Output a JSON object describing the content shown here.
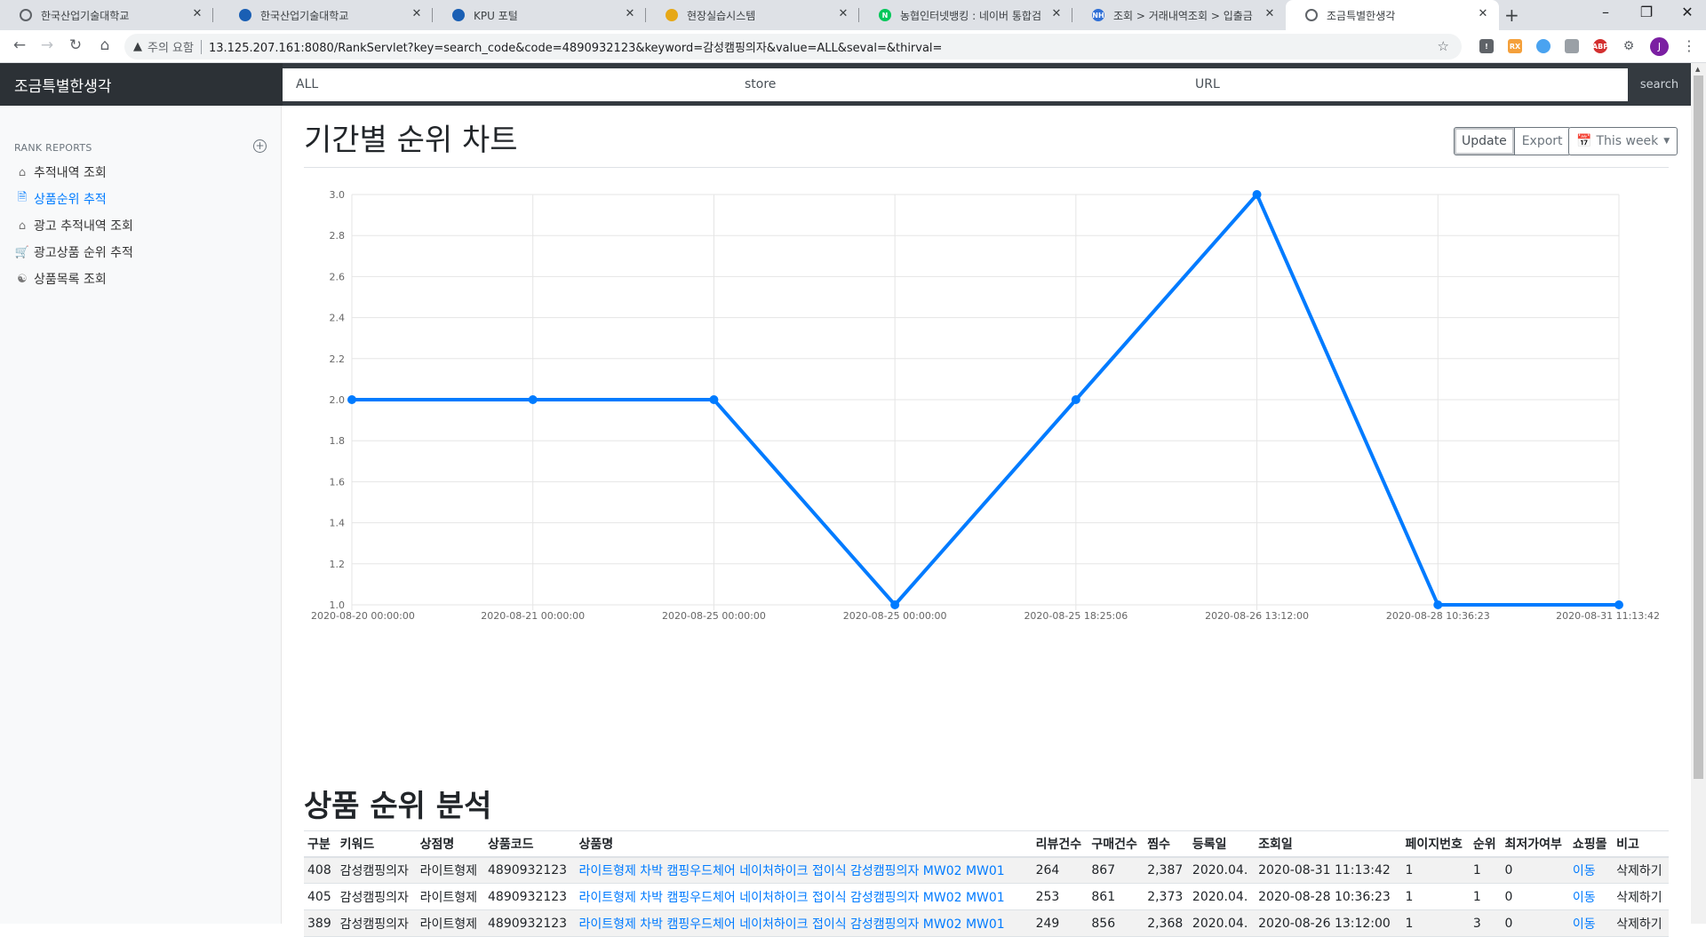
{
  "browser": {
    "tabs": [
      {
        "title": "한국산업기술대학교",
        "fav": "globe",
        "fav_color": "#5f6368"
      },
      {
        "title": "한국산업기술대학교",
        "fav": "kpu",
        "fav_color": "#1a5fb4"
      },
      {
        "title": "KPU 포털",
        "fav": "kpu",
        "fav_color": "#1a5fb4"
      },
      {
        "title": "현장실습시스템",
        "fav": "emblem",
        "fav_color": "#e6a817"
      },
      {
        "title": "농협인터넷뱅킹 : 네이버 통합검",
        "fav": "N",
        "fav_color": "#03c75a"
      },
      {
        "title": "조회 > 거래내역조회 > 입출금",
        "fav": "NH",
        "fav_color": "#2f6fd6"
      },
      {
        "title": "조금특별한생각",
        "fav": "globe",
        "fav_color": "#5f6368",
        "active": true
      }
    ],
    "security_label": "주의 요함",
    "url": "13.125.207.161:8080/RankServlet?key=search_code&code=4890932123&keyword=감성캠핑의자&value=ALL&seval=&thirval=",
    "profile_initial": "J"
  },
  "navbar": {
    "brand": "조금특별한생각",
    "search_fields": [
      "ALL",
      "store",
      "URL"
    ],
    "search_button": "search"
  },
  "sidebar": {
    "heading": "RANK REPORTS",
    "items": [
      {
        "label": "추적내역 조회",
        "icon": "home-icon"
      },
      {
        "label": "상품순위 추적",
        "icon": "file-icon",
        "active": true
      },
      {
        "label": "광고 추적내역 조회",
        "icon": "home-icon"
      },
      {
        "label": "광고상품 순위 추적",
        "icon": "cart-icon"
      },
      {
        "label": "상품목록 조회",
        "icon": "users-icon"
      }
    ]
  },
  "main": {
    "title": "기간별 순위 차트",
    "buttons": {
      "update": "Update",
      "export": "Export",
      "period": "This week"
    },
    "section_title": "상품 순위 분석"
  },
  "chart_data": {
    "type": "line",
    "x": [
      "2020-08-20 00:00:00",
      "2020-08-21 00:00:00",
      "2020-08-25 00:00:00",
      "2020-08-25 00:00:00",
      "2020-08-25 18:25:06",
      "2020-08-26 13:12:00",
      "2020-08-28 10:36:23",
      "2020-08-31 11:13:42"
    ],
    "series": [
      {
        "values": [
          2,
          2,
          2,
          1,
          2,
          3,
          1,
          1
        ]
      }
    ],
    "y_ticks": [
      "3.0",
      "2.8",
      "2.6",
      "2.4",
      "2.2",
      "2.0",
      "1.8",
      "1.6",
      "1.4",
      "1.2",
      "1.0"
    ],
    "ylim": [
      1,
      3
    ],
    "grid": true,
    "color": "#007bff"
  },
  "table": {
    "columns": [
      "구분",
      "키워드",
      "상점명",
      "상품코드",
      "상품명",
      "리뷰건수",
      "구매건수",
      "찜수",
      "등록일",
      "조회일",
      "페이지번호",
      "순위",
      "최저가여부",
      "쇼핑몰",
      "비고"
    ],
    "rows": [
      [
        "408",
        "감성캠핑의자",
        "라이트형제",
        "4890932123",
        "라이트형제 차박 캠핑우드체어 네이처하이크 접이식 감성캠핑의자 MW02 MW01",
        "264",
        "867",
        "2,387",
        "2020.04.",
        "2020-08-31 11:13:42",
        "1",
        "1",
        "0",
        "이동",
        "삭제하기"
      ],
      [
        "405",
        "감성캠핑의자",
        "라이트형제",
        "4890932123",
        "라이트형제 차박 캠핑우드체어 네이처하이크 접이식 감성캠핑의자 MW02 MW01",
        "253",
        "861",
        "2,373",
        "2020.04.",
        "2020-08-28 10:36:23",
        "1",
        "1",
        "0",
        "이동",
        "삭제하기"
      ],
      [
        "389",
        "감성캠핑의자",
        "라이트형제",
        "4890932123",
        "라이트형제 차박 캠핑우드체어 네이처하이크 접이식 감성캠핑의자 MW02 MW01",
        "249",
        "856",
        "2,368",
        "2020.04.",
        "2020-08-26 13:12:00",
        "1",
        "3",
        "0",
        "이동",
        "삭제하기"
      ]
    ]
  }
}
